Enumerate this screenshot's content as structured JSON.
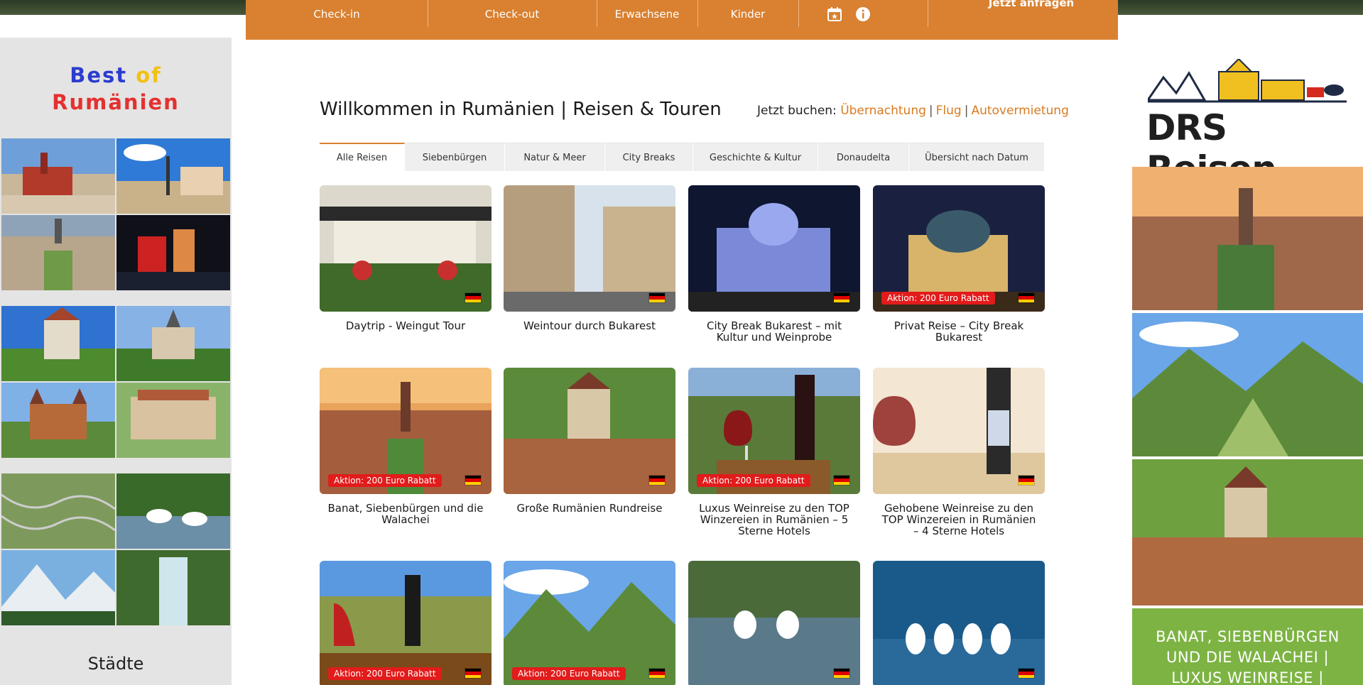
{
  "booking_bar": {
    "checkin_label": "Check-in",
    "checkout_label": "Check-out",
    "adults_label": "Erwachsene",
    "children_label": "Kinder",
    "cta_label": "Jetzt anfragen",
    "background": "#d98131"
  },
  "left_sidebar": {
    "brand_best": "Best",
    "brand_of": "of",
    "brand_country": "Rumänien",
    "caption": "Städte"
  },
  "right_sidebar": {
    "logo_text": "DRS Reisen",
    "promo_line1": "BANAT, SIEBENBÜRGEN",
    "promo_line2": "UND DIE WALACHEI |",
    "promo_line3": "LUXUS WEINREISE |"
  },
  "header": {
    "title": "Willkommen in Rumänien | Reisen & Touren",
    "book_now_label": "Jetzt buchen:",
    "links": [
      "Übernachtung",
      "Flug",
      "Autovermietung"
    ]
  },
  "tabs": [
    {
      "label": "Alle Reisen",
      "active": true
    },
    {
      "label": "Siebenbürgen",
      "active": false
    },
    {
      "label": "Natur & Meer",
      "active": false
    },
    {
      "label": "City Breaks",
      "active": false
    },
    {
      "label": "Geschichte & Kultur",
      "active": false
    },
    {
      "label": "Donaudelta",
      "active": false
    },
    {
      "label": "Übersicht nach Datum",
      "active": false
    }
  ],
  "tours": [
    {
      "title": "Daytrip - Weingut Tour",
      "badge": ""
    },
    {
      "title": "Weintour durch Bukarest",
      "badge": ""
    },
    {
      "title": "City Break Bukarest – mit Kultur und Weinprobe",
      "badge": ""
    },
    {
      "title": "Privat Reise – City Break Bukarest",
      "badge": "Aktion: 200 Euro Rabatt"
    },
    {
      "title": "Banat, Siebenbürgen und die Walachei",
      "badge": "Aktion: 200 Euro Rabatt"
    },
    {
      "title": "Große Rumänien Rundreise",
      "badge": ""
    },
    {
      "title": "Luxus Weinreise zu den TOP Winzereien in Rumänien – 5 Sterne Hotels",
      "badge": "Aktion: 200 Euro Rabatt"
    },
    {
      "title": "Gehobene Weinreise zu den TOP Winzereien in Rumänien – 4 Sterne Hotels",
      "badge": ""
    },
    {
      "title": "",
      "badge": "Aktion: 200 Euro Rabatt"
    },
    {
      "title": "",
      "badge": "Aktion: 200 Euro Rabatt"
    },
    {
      "title": "",
      "badge": ""
    },
    {
      "title": "",
      "badge": ""
    }
  ],
  "colors": {
    "accent": "#d98131",
    "link": "#d97a1f",
    "badge": "#e21b1b",
    "promo_green": "#7db343"
  }
}
